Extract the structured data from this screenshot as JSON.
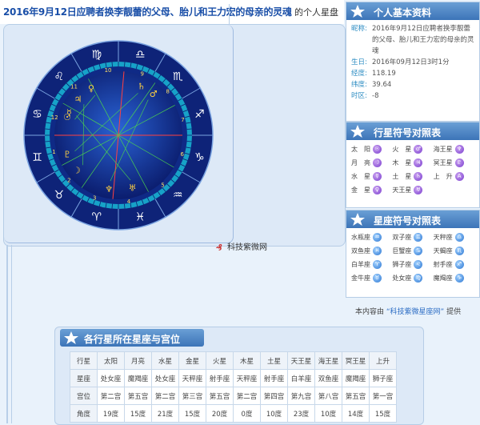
{
  "header": {
    "title": "2016年9月12日应聘者换李靓蕾的父母、胎儿和王力宏的母亲的灵魂",
    "subtitle": "的个人星盘"
  },
  "chart": {
    "watermark": "科技紫微网",
    "zodiac_glyphs": [
      "♋",
      "♌",
      "♍",
      "♎",
      "♏",
      "♐",
      "♑",
      "♒",
      "♓",
      "♈",
      "♉",
      "♊"
    ],
    "house_numbers": [
      "1",
      "2",
      "3",
      "4",
      "5",
      "6",
      "7",
      "8",
      "9",
      "10",
      "11",
      "12"
    ],
    "planet_glyphs": [
      "☉",
      "☽",
      "☿",
      "♀",
      "♂",
      "♃",
      "♄",
      "♅",
      "♆",
      "♇"
    ]
  },
  "profile": {
    "heading": "个人基本资料",
    "rows": [
      {
        "k": "昵称:",
        "v": "2016年9月12日应聘者换李靓蕾的父母、胎儿和王力宏的母亲的灵魂"
      },
      {
        "k": "生日:",
        "v": "2016年09月12日3时1分"
      },
      {
        "k": "经度:",
        "v": "118.19"
      },
      {
        "k": "纬度:",
        "v": "39.64"
      },
      {
        "k": "时区:",
        "v": "-8"
      }
    ]
  },
  "planet_symbols": {
    "heading": "行星符号对照表",
    "items": [
      {
        "label": "太　阳",
        "glyph": "☉"
      },
      {
        "label": "火　星",
        "glyph": "♂"
      },
      {
        "label": "海王星",
        "glyph": "♆"
      },
      {
        "label": "月　亮",
        "glyph": "☽"
      },
      {
        "label": "木　星",
        "glyph": "♃"
      },
      {
        "label": "冥王星",
        "glyph": "♇"
      },
      {
        "label": "水　星",
        "glyph": "☿"
      },
      {
        "label": "土　星",
        "glyph": "♄"
      },
      {
        "label": "上　升",
        "glyph": "A"
      },
      {
        "label": "金　星",
        "glyph": "♀"
      },
      {
        "label": "天王星",
        "glyph": "♅"
      }
    ]
  },
  "sign_symbols": {
    "heading": "星座符号对照表",
    "items": [
      {
        "label": "水瓶座",
        "glyph": "♒"
      },
      {
        "label": "双子座",
        "glyph": "♊"
      },
      {
        "label": "天秤座",
        "glyph": "♎"
      },
      {
        "label": "双鱼座",
        "glyph": "♓"
      },
      {
        "label": "巨蟹座",
        "glyph": "♋"
      },
      {
        "label": "天蝎座",
        "glyph": "♏"
      },
      {
        "label": "白羊座",
        "glyph": "♈"
      },
      {
        "label": "狮子座",
        "glyph": "♌"
      },
      {
        "label": "射手座",
        "glyph": "♐"
      },
      {
        "label": "金牛座",
        "glyph": "♉"
      },
      {
        "label": "处女座",
        "glyph": "♍"
      },
      {
        "label": "魔羯座",
        "glyph": "♑"
      }
    ]
  },
  "credit": {
    "prefix": "本内容由",
    "link": "“科技紫微星座网”",
    "suffix": "提供"
  },
  "positions": {
    "heading": "各行星所在星座与宫位",
    "rows": [
      [
        "行星",
        "太阳",
        "月亮",
        "水星",
        "金星",
        "火星",
        "木星",
        "土星",
        "天王星",
        "海王星",
        "冥王星",
        "上升"
      ],
      [
        "星座",
        "处女座",
        "魔羯座",
        "处女座",
        "天秤座",
        "射手座",
        "天秤座",
        "射手座",
        "白羊座",
        "双鱼座",
        "魔羯座",
        "狮子座"
      ],
      [
        "宫位",
        "第二宫",
        "第五宫",
        "第二宫",
        "第三宫",
        "第五宫",
        "第二宫",
        "第四宫",
        "第九宫",
        "第八宫",
        "第五宫",
        "第一宫"
      ],
      [
        "角度",
        "19度",
        "15度",
        "21度",
        "15度",
        "20度",
        "0度",
        "10度",
        "23度",
        "10度",
        "14度",
        "15度"
      ]
    ]
  }
}
